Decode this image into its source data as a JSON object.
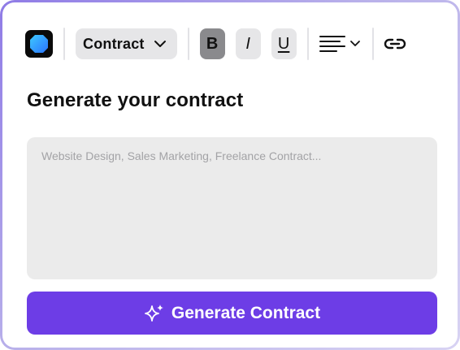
{
  "toolbar": {
    "logo_icon": "app-logo-icon",
    "type_dropdown": {
      "selected": "Contract",
      "icon": "chevron-down-icon"
    },
    "bold_label": "B",
    "italic_label": "I",
    "underline_label": "U",
    "align_icon": "align-left-icon",
    "link_icon": "link-icon"
  },
  "heading": "Generate your contract",
  "prompt": {
    "value": "",
    "placeholder": "Website Design, Sales Marketing, Freelance Contract..."
  },
  "generate_button": {
    "label": "Generate Contract",
    "icon": "sparkle-icon"
  },
  "colors": {
    "accent": "#6d3de6",
    "frame_gradient_start": "#8f7be6",
    "frame_gradient_end": "#d8d3f3",
    "logo_gradient_start": "#3ec9ff",
    "logo_gradient_end": "#2b74ff",
    "control_bg": "#e6e6e8",
    "active_control_bg": "#8a8a8d",
    "textarea_bg": "#ebebeb"
  }
}
